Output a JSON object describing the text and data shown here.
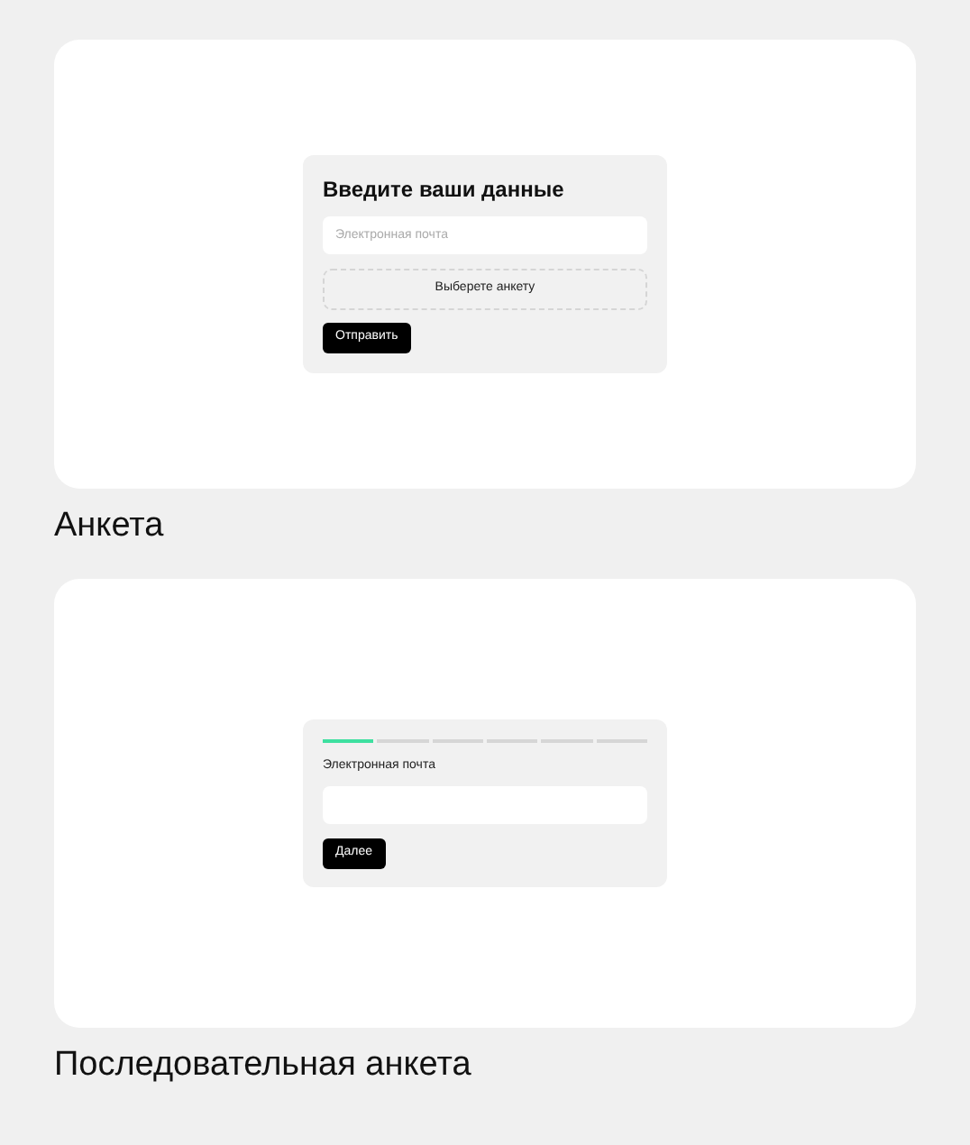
{
  "cards": [
    {
      "kind": "form",
      "title": "Введите ваши данные",
      "email": {
        "placeholder": "Электронная почта"
      },
      "select_button": "Выберете анкету",
      "submit_button": "Отправить",
      "caption": "Анкета"
    },
    {
      "kind": "stepper",
      "steps": [
        {
          "selected": true
        },
        {
          "selected": false
        },
        {
          "selected": false
        },
        {
          "selected": false
        },
        {
          "selected": false
        },
        {
          "selected": false
        }
      ],
      "field_label": "Электронная почта",
      "next_button": "Далее",
      "caption": "Последовательная анкета"
    }
  ]
}
